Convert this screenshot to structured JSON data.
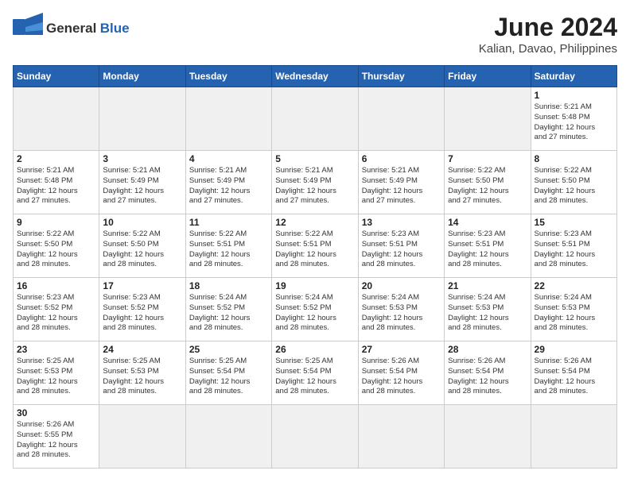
{
  "header": {
    "logo_general": "General",
    "logo_blue": "Blue",
    "month_year": "June 2024",
    "location": "Kalian, Davao, Philippines"
  },
  "weekdays": [
    "Sunday",
    "Monday",
    "Tuesday",
    "Wednesday",
    "Thursday",
    "Friday",
    "Saturday"
  ],
  "weeks": [
    [
      {
        "day": "",
        "info": ""
      },
      {
        "day": "",
        "info": ""
      },
      {
        "day": "",
        "info": ""
      },
      {
        "day": "",
        "info": ""
      },
      {
        "day": "",
        "info": ""
      },
      {
        "day": "",
        "info": ""
      },
      {
        "day": "1",
        "info": "Sunrise: 5:21 AM\nSunset: 5:48 PM\nDaylight: 12 hours\nand 27 minutes."
      }
    ],
    [
      {
        "day": "2",
        "info": "Sunrise: 5:21 AM\nSunset: 5:48 PM\nDaylight: 12 hours\nand 27 minutes."
      },
      {
        "day": "3",
        "info": "Sunrise: 5:21 AM\nSunset: 5:49 PM\nDaylight: 12 hours\nand 27 minutes."
      },
      {
        "day": "4",
        "info": "Sunrise: 5:21 AM\nSunset: 5:49 PM\nDaylight: 12 hours\nand 27 minutes."
      },
      {
        "day": "5",
        "info": "Sunrise: 5:21 AM\nSunset: 5:49 PM\nDaylight: 12 hours\nand 27 minutes."
      },
      {
        "day": "6",
        "info": "Sunrise: 5:21 AM\nSunset: 5:49 PM\nDaylight: 12 hours\nand 27 minutes."
      },
      {
        "day": "7",
        "info": "Sunrise: 5:22 AM\nSunset: 5:50 PM\nDaylight: 12 hours\nand 27 minutes."
      },
      {
        "day": "8",
        "info": "Sunrise: 5:22 AM\nSunset: 5:50 PM\nDaylight: 12 hours\nand 28 minutes."
      }
    ],
    [
      {
        "day": "9",
        "info": "Sunrise: 5:22 AM\nSunset: 5:50 PM\nDaylight: 12 hours\nand 28 minutes."
      },
      {
        "day": "10",
        "info": "Sunrise: 5:22 AM\nSunset: 5:50 PM\nDaylight: 12 hours\nand 28 minutes."
      },
      {
        "day": "11",
        "info": "Sunrise: 5:22 AM\nSunset: 5:51 PM\nDaylight: 12 hours\nand 28 minutes."
      },
      {
        "day": "12",
        "info": "Sunrise: 5:22 AM\nSunset: 5:51 PM\nDaylight: 12 hours\nand 28 minutes."
      },
      {
        "day": "13",
        "info": "Sunrise: 5:23 AM\nSunset: 5:51 PM\nDaylight: 12 hours\nand 28 minutes."
      },
      {
        "day": "14",
        "info": "Sunrise: 5:23 AM\nSunset: 5:51 PM\nDaylight: 12 hours\nand 28 minutes."
      },
      {
        "day": "15",
        "info": "Sunrise: 5:23 AM\nSunset: 5:51 PM\nDaylight: 12 hours\nand 28 minutes."
      }
    ],
    [
      {
        "day": "16",
        "info": "Sunrise: 5:23 AM\nSunset: 5:52 PM\nDaylight: 12 hours\nand 28 minutes."
      },
      {
        "day": "17",
        "info": "Sunrise: 5:23 AM\nSunset: 5:52 PM\nDaylight: 12 hours\nand 28 minutes."
      },
      {
        "day": "18",
        "info": "Sunrise: 5:24 AM\nSunset: 5:52 PM\nDaylight: 12 hours\nand 28 minutes."
      },
      {
        "day": "19",
        "info": "Sunrise: 5:24 AM\nSunset: 5:52 PM\nDaylight: 12 hours\nand 28 minutes."
      },
      {
        "day": "20",
        "info": "Sunrise: 5:24 AM\nSunset: 5:53 PM\nDaylight: 12 hours\nand 28 minutes."
      },
      {
        "day": "21",
        "info": "Sunrise: 5:24 AM\nSunset: 5:53 PM\nDaylight: 12 hours\nand 28 minutes."
      },
      {
        "day": "22",
        "info": "Sunrise: 5:24 AM\nSunset: 5:53 PM\nDaylight: 12 hours\nand 28 minutes."
      }
    ],
    [
      {
        "day": "23",
        "info": "Sunrise: 5:25 AM\nSunset: 5:53 PM\nDaylight: 12 hours\nand 28 minutes."
      },
      {
        "day": "24",
        "info": "Sunrise: 5:25 AM\nSunset: 5:53 PM\nDaylight: 12 hours\nand 28 minutes."
      },
      {
        "day": "25",
        "info": "Sunrise: 5:25 AM\nSunset: 5:54 PM\nDaylight: 12 hours\nand 28 minutes."
      },
      {
        "day": "26",
        "info": "Sunrise: 5:25 AM\nSunset: 5:54 PM\nDaylight: 12 hours\nand 28 minutes."
      },
      {
        "day": "27",
        "info": "Sunrise: 5:26 AM\nSunset: 5:54 PM\nDaylight: 12 hours\nand 28 minutes."
      },
      {
        "day": "28",
        "info": "Sunrise: 5:26 AM\nSunset: 5:54 PM\nDaylight: 12 hours\nand 28 minutes."
      },
      {
        "day": "29",
        "info": "Sunrise: 5:26 AM\nSunset: 5:54 PM\nDaylight: 12 hours\nand 28 minutes."
      }
    ],
    [
      {
        "day": "30",
        "info": "Sunrise: 5:26 AM\nSunset: 5:55 PM\nDaylight: 12 hours\nand 28 minutes."
      },
      {
        "day": "",
        "info": ""
      },
      {
        "day": "",
        "info": ""
      },
      {
        "day": "",
        "info": ""
      },
      {
        "day": "",
        "info": ""
      },
      {
        "day": "",
        "info": ""
      },
      {
        "day": "",
        "info": ""
      }
    ]
  ]
}
